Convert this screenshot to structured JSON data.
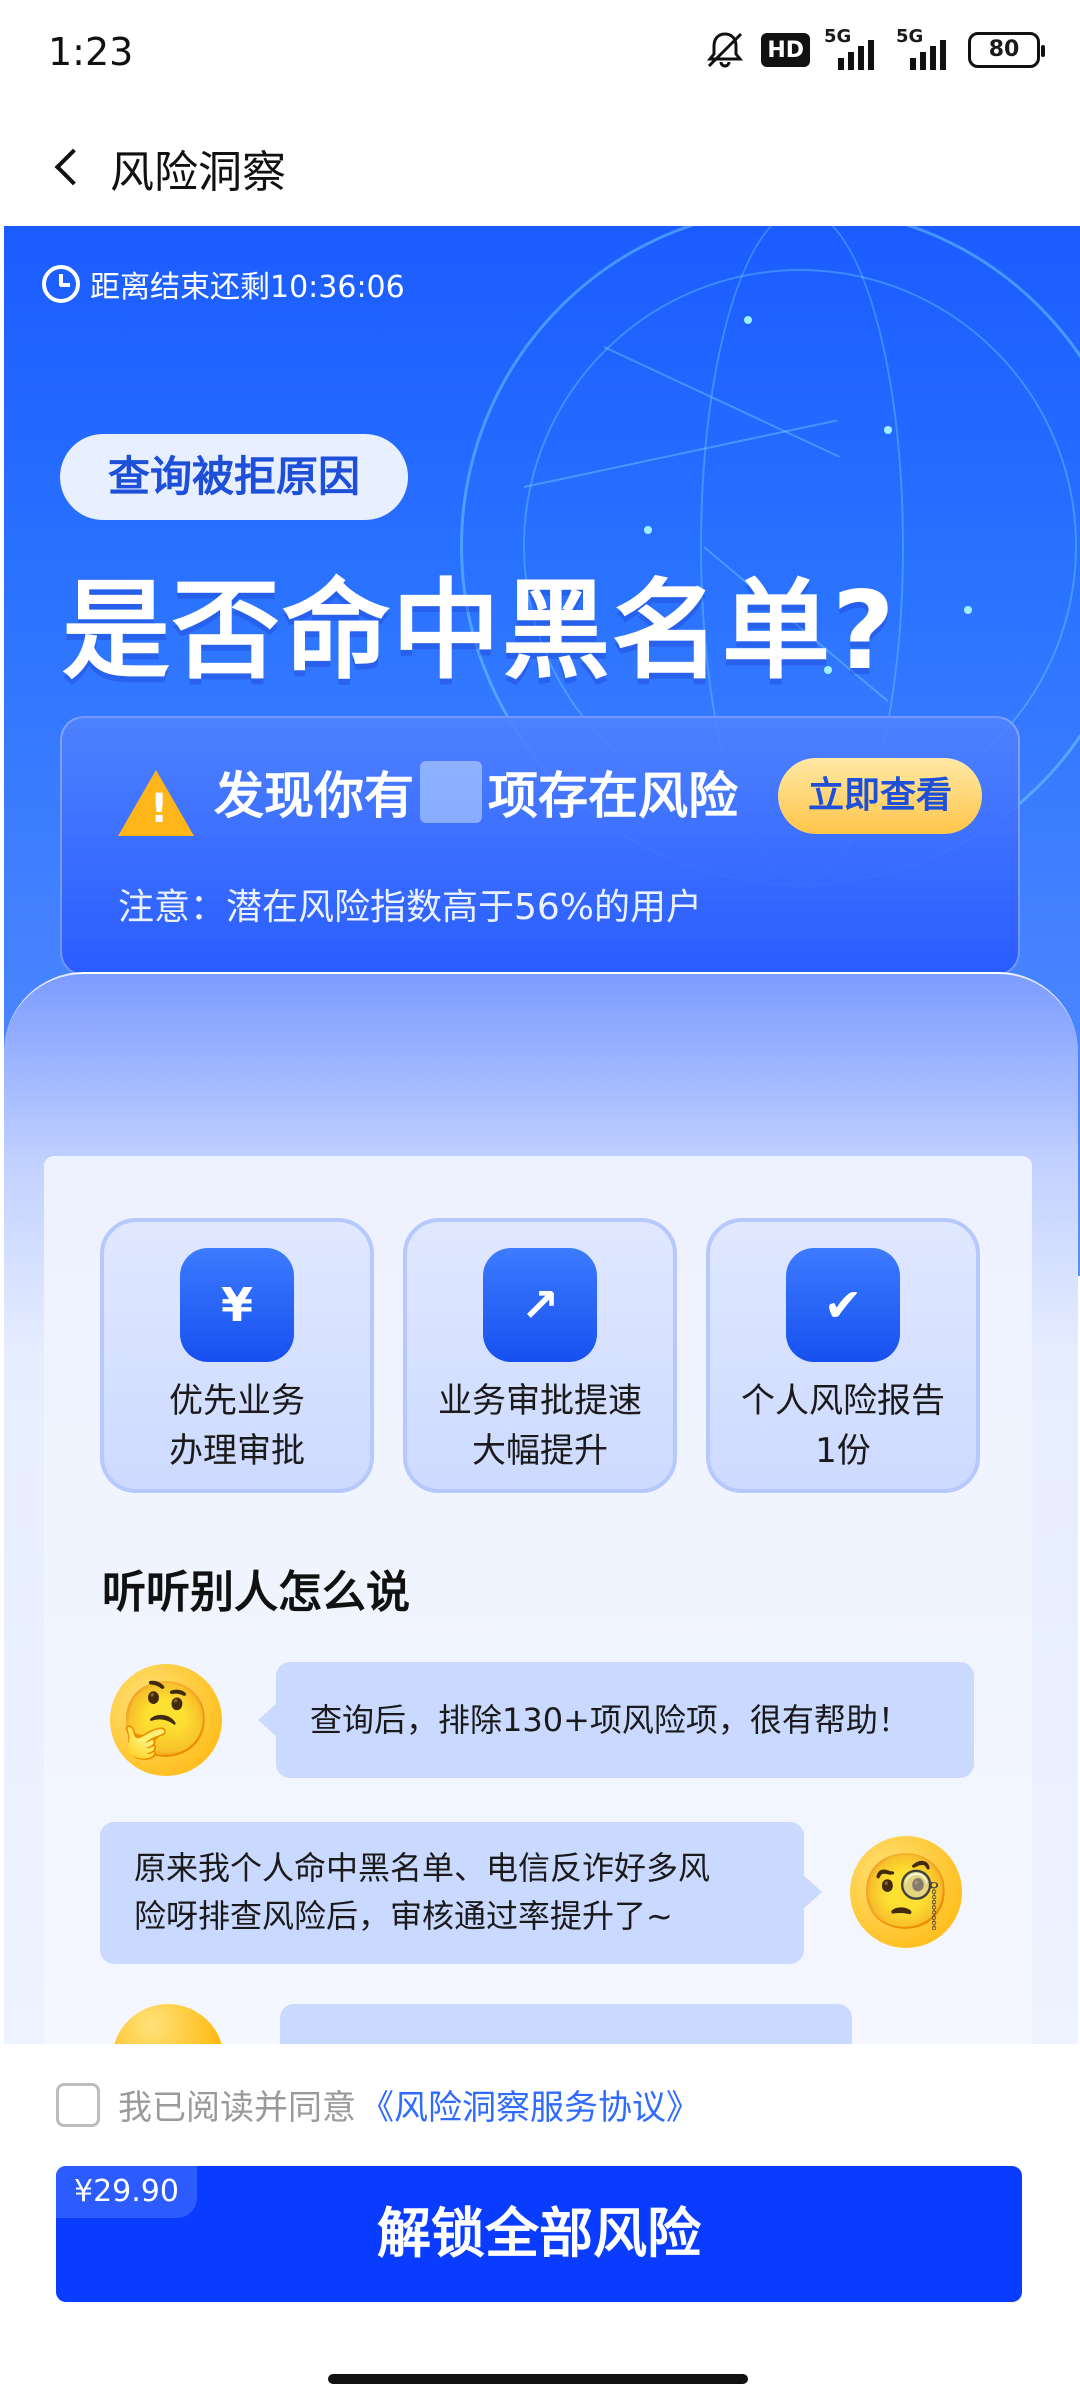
{
  "status_bar": {
    "time": "1:23",
    "hd_label": "HD",
    "signal1_label": "5G",
    "signal2_label": "5G",
    "battery": "80"
  },
  "header": {
    "title": "风险洞察"
  },
  "banner": {
    "countdown": "距离结束还剩10:36:06",
    "tag": "查询被拒原因",
    "headline": "是否命中黑名单?",
    "risk_prefix": "发现你有",
    "risk_suffix": "项存在风险",
    "view_button": "立即查看",
    "note": "注意：潜在风险指数高于56%的用户",
    "colors": {
      "primary": "#1b5cff",
      "accent": "#ffc54a",
      "warning": "#ffb61a"
    }
  },
  "features": [
    {
      "icon": "ticket-yuan-icon",
      "glyph": "¥",
      "line1": "优先业务",
      "line2": "办理审批"
    },
    {
      "icon": "trend-up-icon",
      "glyph": "↗",
      "line1": "业务审批提速",
      "line2": "大幅提升"
    },
    {
      "icon": "report-check-icon",
      "glyph": "✔",
      "line1": "个人风险报告",
      "line2": "1份"
    }
  ],
  "testimonials": {
    "title": "听听别人怎么说",
    "items": [
      {
        "emoji": "🤔",
        "text": "查询后，排除130+项风险项，很有帮助！"
      },
      {
        "emoji": "🧐",
        "line1": "原来我个人命中黑名单、电信反诈好多风",
        "line2": "险呀排查风险后，审核通过率提升了~"
      }
    ]
  },
  "bottom": {
    "agree_text": "我已阅读并同意",
    "agree_link": "《风险洞察服务协议》",
    "price": "¥29.90",
    "unlock_button": "解锁全部风险"
  }
}
